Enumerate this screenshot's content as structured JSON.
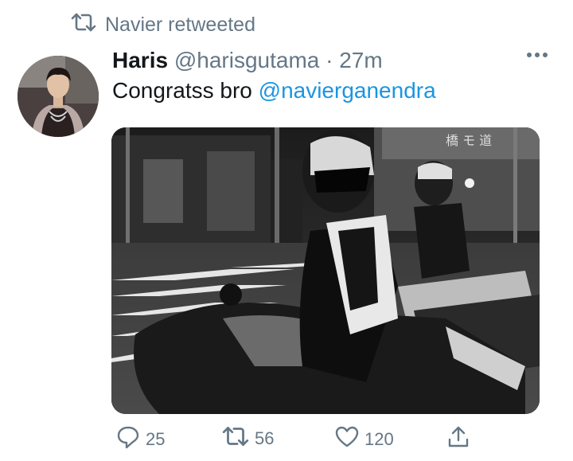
{
  "retweet_context": {
    "icon": "retweet-icon",
    "label": "Navier retweeted"
  },
  "tweet": {
    "author_name": "Haris",
    "author_handle": "@harisgutama",
    "separator": "·",
    "time": "27m",
    "text_prefix": "Congratss bro ",
    "mention": "@navierganendra",
    "media": {
      "sign_text": "橋 モ 道"
    }
  },
  "actions": {
    "reply_count": "25",
    "retweet_count": "56",
    "like_count": "120"
  },
  "colors": {
    "accent": "#1b95e0",
    "muted": "#657786",
    "text": "#14171a"
  }
}
